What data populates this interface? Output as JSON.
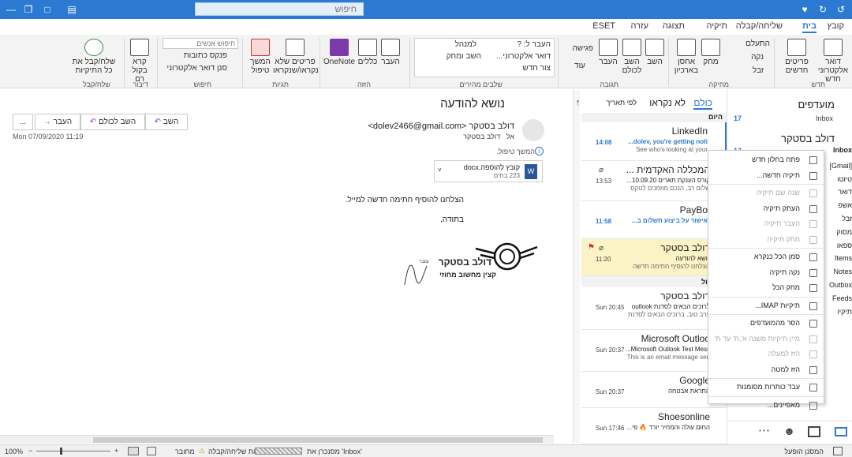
{
  "search": {
    "placeholder": "חיפוש"
  },
  "tabs": [
    "קובץ",
    "בית",
    "שליחה/קבלה",
    "תיקיה",
    "תצוגה",
    "עזרה",
    "ESET"
  ],
  "ribbon": {
    "groups": [
      "חדש",
      "מחיקה",
      "תגובה",
      "שלבים מהירים",
      "הזזה",
      "תגיות",
      "חיפוש",
      "דיבור",
      "שלח/קבל"
    ],
    "new_email": "דואר אלקטרוני חדש",
    "new_items": "פריטים חדשים",
    "ignore": "התעלם",
    "clean": "נקה",
    "junk": "זבל",
    "delete": "מחק",
    "archive": "אחסן בארכיון",
    "reply": "השב",
    "reply_all": "השב לכולם",
    "forward": "העבר",
    "meeting": "פגישה",
    "more": "עוד",
    "quick1": "העבר ל: ?",
    "quick2": "דואר אלקטרוני...",
    "quick3": "צור חדש",
    "quick4": "למנהל",
    "quick5": "השב ומחק",
    "move": "העבר",
    "rules": "כללים",
    "onenote": "OneNote",
    "unread_read": "פריטים שלא נקראו/שנקראו",
    "followup": "המשך טיפול",
    "search_people": "חיפוש אנשים",
    "address_book": "פנקס כתובות",
    "filter_email": "סנן דואר אלקטרוני",
    "read_aloud": "קרא בקול רם",
    "send_receive_all": "שלח/קבל את כל התיקיות"
  },
  "folders": {
    "favorites": "מועדפים",
    "inbox": "Inbox",
    "inbox_count": "17",
    "account": "דולב בסטקר",
    "inbox2": "Inbox",
    "inbox2_count": "17",
    "partial": [
      "[Gmail]",
      "טיוטו",
      "דואר",
      "אשפ",
      "זבל",
      "מסוק",
      "ספאו",
      "Items",
      "Notes",
      "Outbox",
      "Feeds",
      "תיקיו"
    ]
  },
  "list": {
    "tab_all": "כולם",
    "tab_unread": "לא נקראו",
    "sort": "לפי תאריך",
    "group_today": "היום",
    "group_yesterday": "אתמול",
    "messages": [
      {
        "sender": "LinkedIn",
        "subject": "dolev, you're getting noti...",
        "preview": "See who's looking at your",
        "time": "14:08",
        "unread": true
      },
      {
        "sender": "המכללה האקדמית ...",
        "subject": "קורס הענקת תארים 10.09.20...",
        "preview": "שלום רב, הנכם מוזמנים לטקס",
        "time": "13:53",
        "unread": false,
        "attachment": true
      },
      {
        "sender": "PayBo",
        "subject": "אישור על ביצוע תשלום ב...",
        "preview": "",
        "time": "11:58",
        "unread": true
      },
      {
        "sender": "דולב בסטקר",
        "subject": "נושא להודעה",
        "preview": "הצלחנו להוסיף חתימה חדשה",
        "time": "11:20",
        "unread": false,
        "flag": true,
        "attachment": true
      },
      {
        "sender": "דולב בסטקר",
        "subject": "לרוכים הבאים לסדנת outlook",
        "preview": "ערב טוב, ברוכים הבאים לסדנת",
        "time": "Sun 20:45",
        "unread": false
      },
      {
        "sender": "Microsoft Outloo",
        "subject": "Microsoft Outlook Test Mess...",
        "preview": "This is an email message sen",
        "time": "Sun 20:37",
        "unread": false
      },
      {
        "sender": "Google",
        "subject": "התראת אבטחה",
        "preview": "",
        "time": "Sun 20:37",
        "unread": false
      },
      {
        "sender": "Shoesonline",
        "subject": "החום עולה והמחיר יורד 🔥 פי...",
        "preview": "",
        "time": "Sun 17:46",
        "unread": false
      }
    ]
  },
  "reading": {
    "subject": "נושא להודעה",
    "reply": "השב",
    "reply_all": "השב לכולם",
    "forward": "העבר",
    "more": "...",
    "from": "דולב בסטקר <dolev2466@gmail.com>",
    "to_label": "אל",
    "to": "דולב בסטקר",
    "date": "Mon 07/09/2020 11:19",
    "followup": "המשך טיפול.",
    "attach_name": "קובץ להוספה.docx",
    "attach_size": "223 בתים",
    "body1": "הצלחנו להוסיף חתימה חדשה למייל.",
    "body2": "בתודה,",
    "sig_name": "דולב בסטקר",
    "sig_small": "צובר",
    "sig_sub": "קצין מחשוב מחוזי"
  },
  "context_menu": [
    {
      "label": "פתח בחלון חדש",
      "disabled": false
    },
    {
      "label": "תיקיה חדשה...",
      "disabled": false
    },
    {
      "sep": true
    },
    {
      "label": "שנה שם תיקיה",
      "disabled": true
    },
    {
      "label": "העתק תיקיה",
      "disabled": false
    },
    {
      "label": "העבר תיקיה",
      "disabled": true
    },
    {
      "label": "מחק תיקיה",
      "disabled": true
    },
    {
      "sep": true
    },
    {
      "label": "סמן הכל כנקרא",
      "disabled": false
    },
    {
      "label": "נקה תיקיה",
      "disabled": false
    },
    {
      "label": "מחק הכל",
      "disabled": false
    },
    {
      "sep": true
    },
    {
      "label": "תיקיות IMAP...",
      "disabled": false
    },
    {
      "sep": true
    },
    {
      "label": "הסר מהמועדפים",
      "disabled": false
    },
    {
      "label": "מיין תיקיות משנה א',ת' עד ת'",
      "disabled": true
    },
    {
      "label": "הזז למעלה",
      "disabled": true
    },
    {
      "label": "הזז למטה",
      "disabled": false
    },
    {
      "sep": true
    },
    {
      "label": "עבד כותרות מסומנות",
      "disabled": false
    },
    {
      "sep": true
    },
    {
      "label": "מאפיינים...",
      "disabled": false
    }
  ],
  "status": {
    "zoom": "100%",
    "connected": "מחובר",
    "send_error": "שגיאת שליחה/קבלה",
    "syncing": "מסנכרן את 'Inbox'",
    "remind": "המסנן הופעל"
  },
  "colors": {
    "accent": "#2b79d1",
    "highlight": "#fbf2c5"
  }
}
